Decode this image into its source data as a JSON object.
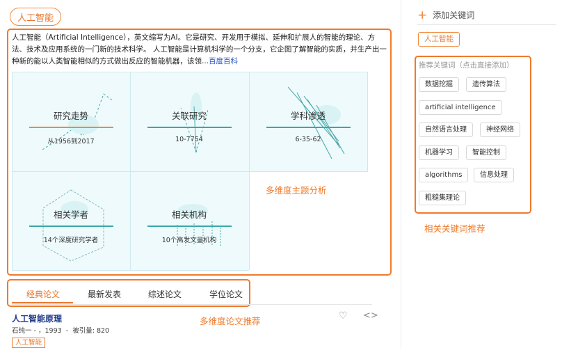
{
  "topic": {
    "tag_label": "人工智能"
  },
  "intro": {
    "text": "人工智能（Artificial Intelligence），英文缩写为AI。它是研究、开发用于模拟、延伸和扩展人的智能的理论、方法、技术及应用系统的一门新的技术科学。 人工智能是计算机科学的一个分支，它企图了解智能的实质，并生产出一种新的能以人类智能相似的方式做出反应的智能机器，该领...",
    "link_label": "百度百科"
  },
  "analysis": {
    "cells": [
      {
        "title": "研究走势",
        "subtitle": "从1956到2017"
      },
      {
        "title": "关联研究",
        "subtitle": "10-7754"
      },
      {
        "title": "学科渗透",
        "subtitle": "6-35-62"
      },
      {
        "title": "相关学者",
        "subtitle": "14个深度研究学者"
      },
      {
        "title": "相关机构",
        "subtitle": "10个高发文量机构"
      }
    ],
    "annotation": "多维度主题分析"
  },
  "tabs": {
    "items": [
      "经典论文",
      "最新发表",
      "综述论文",
      "学位论文"
    ],
    "active": "经典论文",
    "annotation": "多维度论文推荐"
  },
  "paper": {
    "title": "人工智能原理",
    "author": "石纯一 -",
    "year": "1993",
    "cites": "被引量: 820",
    "tag": "人工智能"
  },
  "sidebar": {
    "add_keyword_label": "添加关键词",
    "selected_keyword": "人工智能",
    "recommend_title": "推荐关键词（点击直接添加）",
    "keywords": [
      "数据挖掘",
      "遗传算法",
      "artificial intelligence",
      "自然语言处理",
      "神经网络",
      "机器学习",
      "智能控制",
      "algorithms",
      "信息处理",
      "粗糙集理论"
    ],
    "annotation": "相关关键词推荐"
  },
  "colors": {
    "accent": "#f07a2a",
    "link": "#2a56c6",
    "title_blue": "#1e3a8a",
    "cell_bg": "#eefafc"
  }
}
